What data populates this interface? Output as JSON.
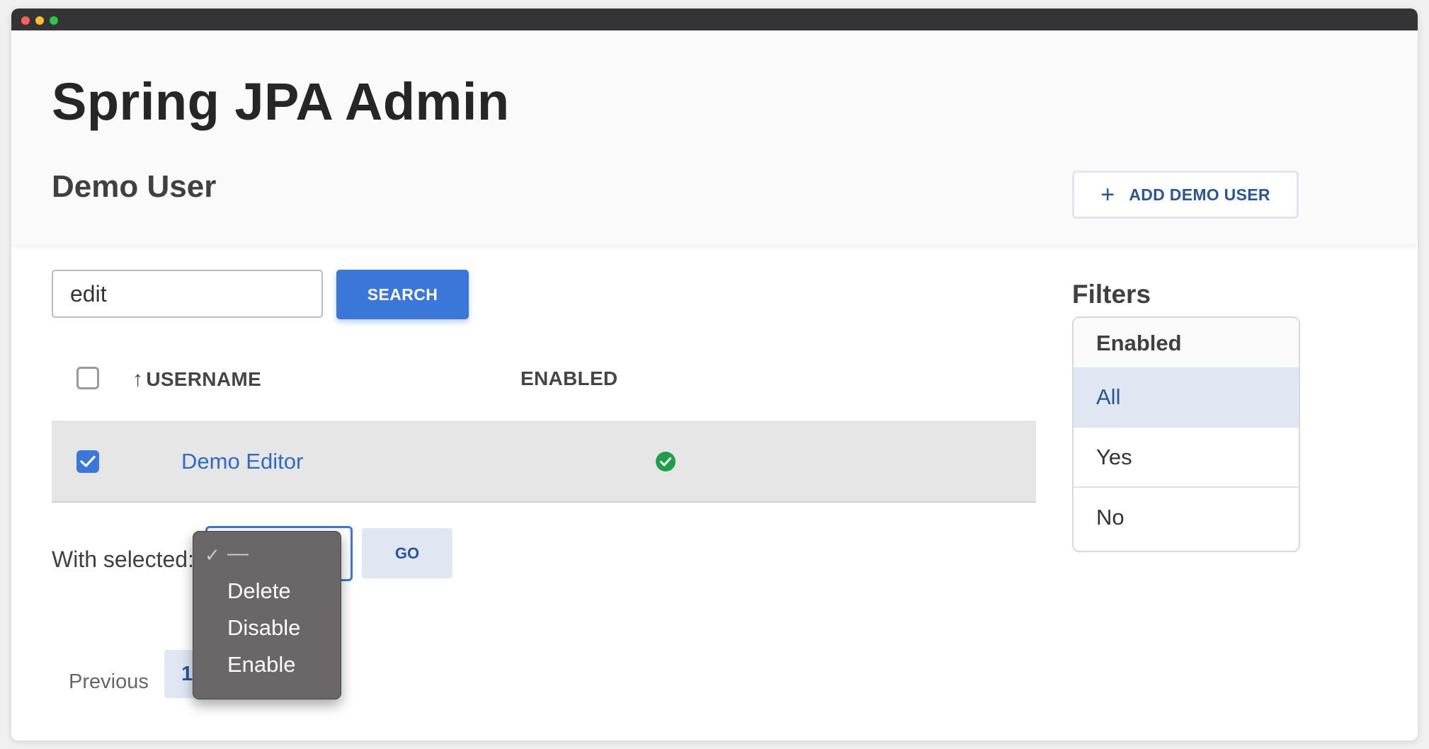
{
  "app": {
    "title": "Spring JPA Admin"
  },
  "page": {
    "title": "Demo User"
  },
  "actions": {
    "add_label": "ADD DEMO USER",
    "add_icon": "plus-icon"
  },
  "search": {
    "value": "edit",
    "button_label": "SEARCH"
  },
  "table": {
    "columns": [
      {
        "label": "USERNAME",
        "sort": "ascending",
        "sort_icon": "arrow-up-icon"
      },
      {
        "label": "ENABLED"
      }
    ],
    "rows": [
      {
        "username": "Demo Editor",
        "enabled": true,
        "selected": true,
        "enabled_icon": "check-circle-icon"
      }
    ]
  },
  "bulk": {
    "label": "With selected:",
    "options": [
      "—",
      "Delete",
      "Disable",
      "Enable"
    ],
    "selected": "—",
    "go_label": "GO"
  },
  "pagination": {
    "previous_label": "Previous",
    "current_page": "1"
  },
  "filters": {
    "title": "Filters",
    "group_label": "Enabled",
    "options": [
      "All",
      "Yes",
      "No"
    ],
    "active": "All"
  },
  "colors": {
    "primary": "#3a77d8",
    "link": "#2e6bc6",
    "success": "#1e9e4a",
    "active_bg": "#dfe7f3"
  }
}
